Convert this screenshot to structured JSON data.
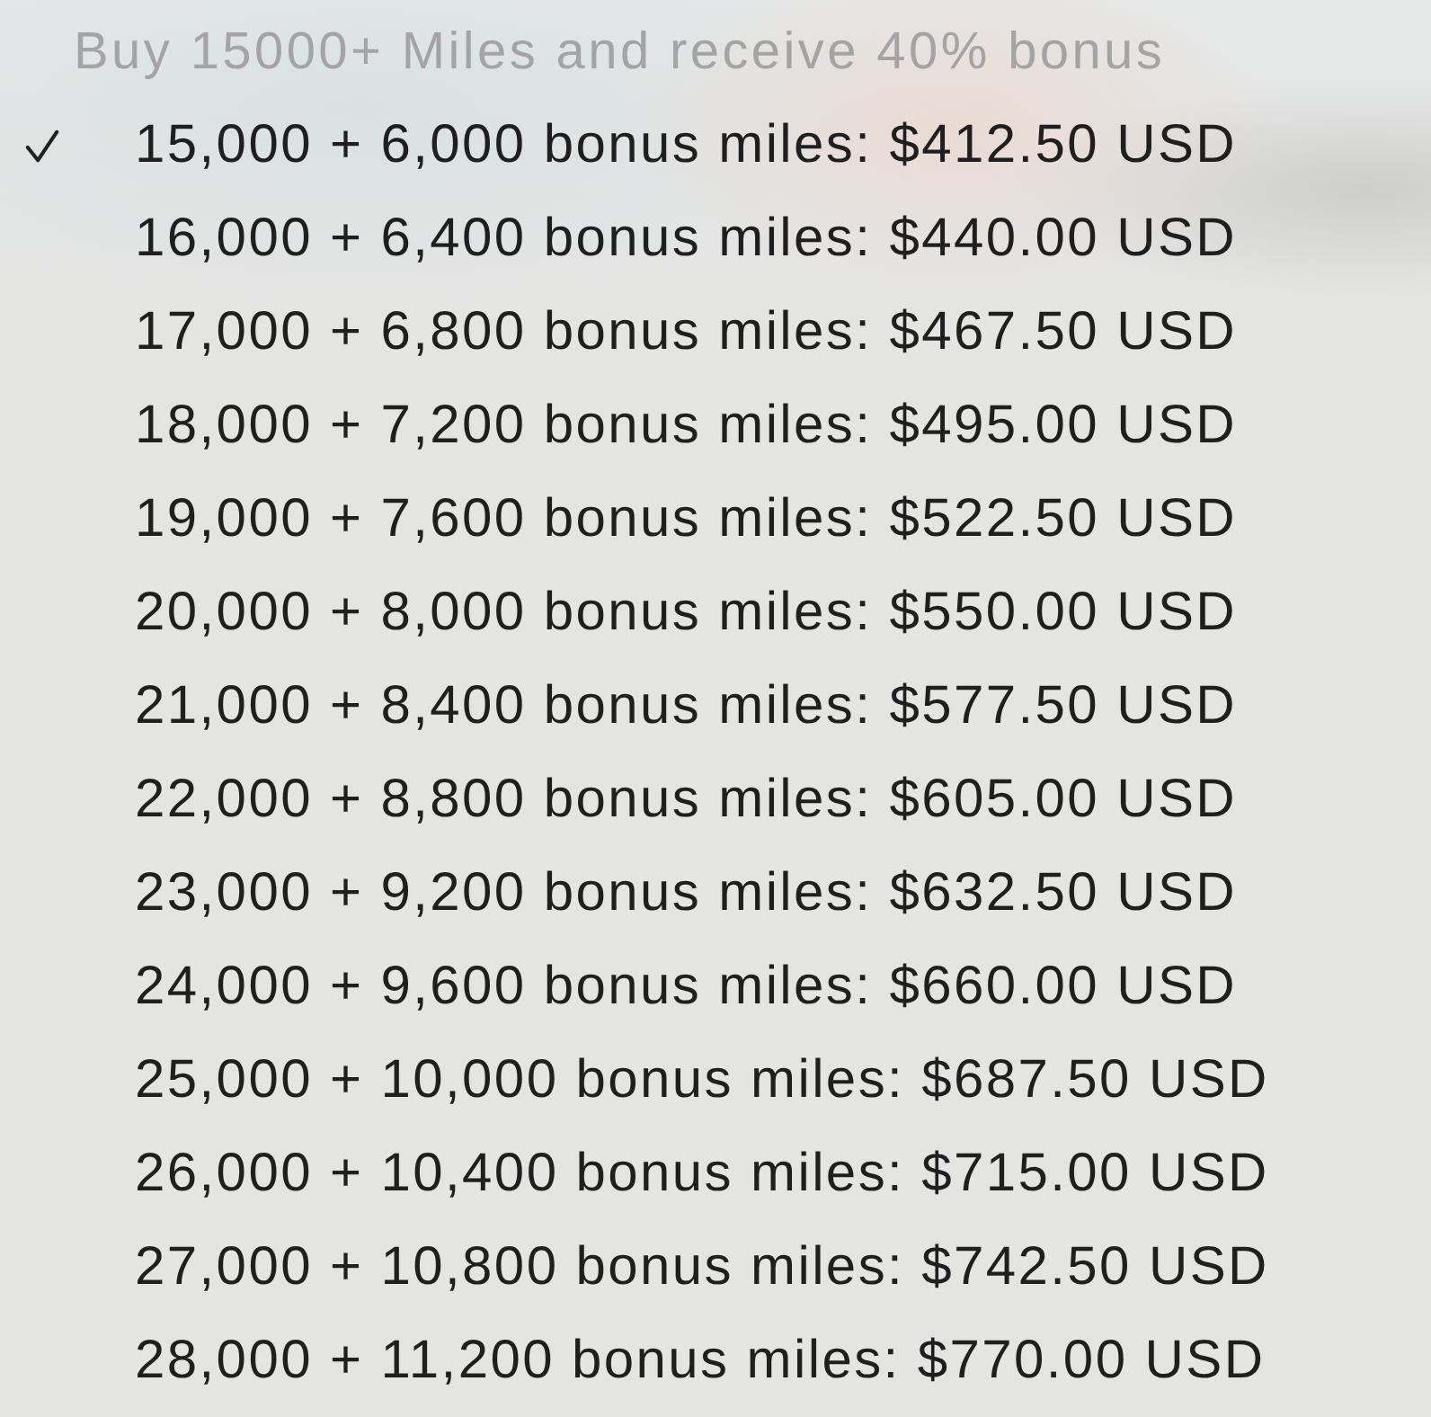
{
  "menu": {
    "header": "Buy 15000+ Miles and receive 40% bonus",
    "options": [
      {
        "label": "15,000 + 6,000 bonus miles: $412.50 USD",
        "selected": true
      },
      {
        "label": "16,000 + 6,400 bonus miles: $440.00 USD",
        "selected": false
      },
      {
        "label": "17,000 + 6,800 bonus miles: $467.50 USD",
        "selected": false
      },
      {
        "label": "18,000 + 7,200 bonus miles: $495.00 USD",
        "selected": false
      },
      {
        "label": "19,000 + 7,600 bonus miles: $522.50 USD",
        "selected": false
      },
      {
        "label": "20,000 + 8,000 bonus miles: $550.00 USD",
        "selected": false
      },
      {
        "label": "21,000 + 8,400 bonus miles: $577.50 USD",
        "selected": false
      },
      {
        "label": "22,000 + 8,800 bonus miles: $605.00 USD",
        "selected": false
      },
      {
        "label": "23,000 + 9,200 bonus miles: $632.50 USD",
        "selected": false
      },
      {
        "label": "24,000 + 9,600 bonus miles: $660.00 USD",
        "selected": false
      },
      {
        "label": "25,000 + 10,000 bonus miles: $687.50 USD",
        "selected": false
      },
      {
        "label": "26,000 + 10,400 bonus miles: $715.00 USD",
        "selected": false
      },
      {
        "label": "27,000 + 10,800 bonus miles: $742.50 USD",
        "selected": false
      },
      {
        "label": "28,000 + 11,200 bonus miles: $770.00 USD",
        "selected": false
      }
    ]
  }
}
